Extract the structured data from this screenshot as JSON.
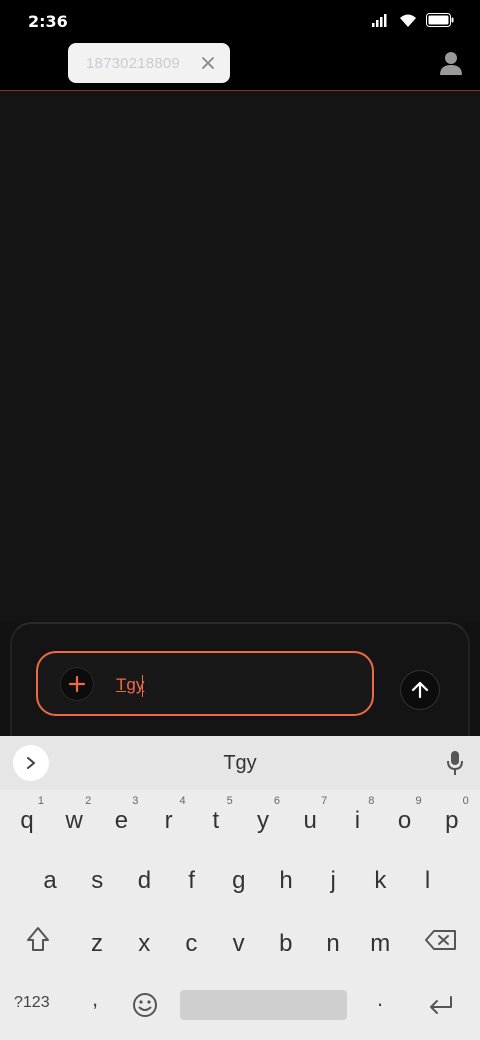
{
  "status": {
    "time": "2:36"
  },
  "header": {
    "recipient_chip": "18730218809",
    "close_icon": "close-icon",
    "profile_icon": "person-icon"
  },
  "composer": {
    "input_value": "Tgy",
    "add_icon": "plus-icon",
    "send_icon": "arrow-up-icon"
  },
  "keyboard": {
    "suggestion": "Tgy",
    "row1": [
      {
        "k": "q",
        "h": "1"
      },
      {
        "k": "w",
        "h": "2"
      },
      {
        "k": "e",
        "h": "3"
      },
      {
        "k": "r",
        "h": "4"
      },
      {
        "k": "t",
        "h": "5"
      },
      {
        "k": "y",
        "h": "6"
      },
      {
        "k": "u",
        "h": "7"
      },
      {
        "k": "i",
        "h": "8"
      },
      {
        "k": "o",
        "h": "9"
      },
      {
        "k": "p",
        "h": "0"
      }
    ],
    "row2": [
      "a",
      "s",
      "d",
      "f",
      "g",
      "h",
      "j",
      "k",
      "l"
    ],
    "row3": [
      "z",
      "x",
      "c",
      "v",
      "b",
      "n",
      "m"
    ],
    "symbols_label": "?123",
    "comma": ",",
    "period": "."
  },
  "colors": {
    "accent": "#ee6a45",
    "background": "#121212",
    "keyboard": "#ececec"
  }
}
